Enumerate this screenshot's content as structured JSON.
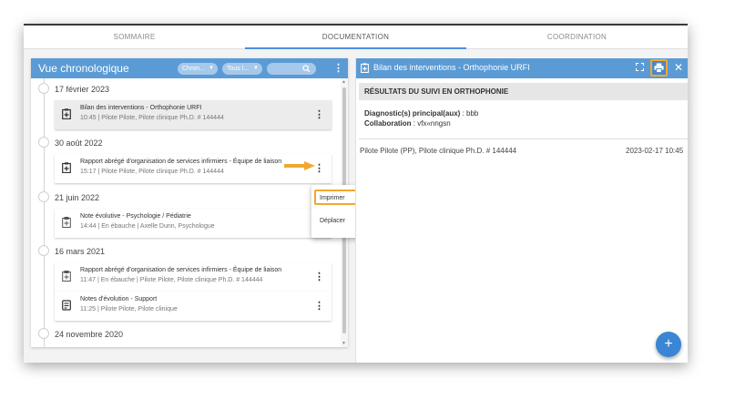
{
  "tabs": [
    {
      "label": "SOMMAIRE"
    },
    {
      "label": "DOCUMENTATION"
    },
    {
      "label": "COORDINATION"
    }
  ],
  "left_panel": {
    "title": "Vue chronologique",
    "filter1": "Chron...",
    "filter2": "Tous l...",
    "search_placeholder": "",
    "groups": [
      {
        "date": "17 février 2023",
        "items": [
          {
            "title": "Bilan des interventions - Orthophonie URFI",
            "meta": "10:45 | Pilote Pilote, Pilote clinique Ph.D. # 144444",
            "icon": "document-plus-icon"
          }
        ]
      },
      {
        "date": "30 août 2022",
        "items": [
          {
            "title": "Rapport abrégé d'organisation de services infirmiers - Équipe de liaison",
            "meta": "15:17 | Pilote Pilote, Pilote clinique Ph.D. # 144444",
            "icon": "document-plus-icon"
          }
        ]
      },
      {
        "date": "21 juin 2022",
        "items": [
          {
            "title": "Note évolutive - Psychologie / Pédiatrie",
            "meta": "14:44 | En ébauche | Axelle Dunn, Psychologue",
            "icon": "document-plus-outline-icon"
          }
        ]
      },
      {
        "date": "16 mars 2021",
        "items": [
          {
            "title": "Rapport abrégé d'organisation de services infirmiers - Équipe de liaison",
            "meta": "11:47 | En ébauche | Pilote Pilote, Pilote clinique Ph.D. # 144444",
            "icon": "document-plus-outline-icon"
          },
          {
            "title": "Notes d'évolution - Support",
            "meta": "11:25 | Pilote Pilote, Pilote clinique",
            "icon": "note-icon"
          }
        ]
      },
      {
        "date": "24 novembre 2020",
        "items": []
      }
    ]
  },
  "context_menu": {
    "items": [
      "Imprimer",
      "Déplacer"
    ]
  },
  "right_panel": {
    "title": "Bilan des interventions - Orthophonie URFI",
    "section_title": "RÉSULTATS DU SUIVI EN ORTHOPHONIE",
    "fields": [
      {
        "label": "Diagnostic(s) principal(aux)",
        "sep": " : ",
        "value": "bbb"
      },
      {
        "label": "Collaboration",
        "sep": " : ",
        "value": "vfx«nngsn"
      }
    ],
    "signature": "Pilote Pilote (PP), Pilote clinique Ph.D. # 144444",
    "signature_date": "2023-02-17 10:45"
  },
  "fab": {
    "label": "+"
  },
  "colors": {
    "header_blue": "#5b9bd5",
    "highlight_orange": "#f0a830",
    "fab_blue": "#3a86d4"
  }
}
